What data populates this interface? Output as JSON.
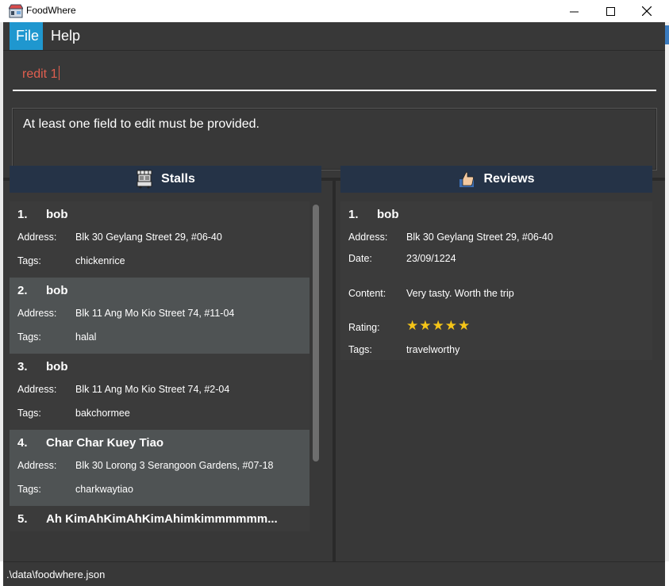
{
  "window": {
    "title": "FoodWhere"
  },
  "menu": {
    "file": "File",
    "help": "Help"
  },
  "command": {
    "value": "redit 1"
  },
  "result": {
    "message": "At least one field to edit must be provided."
  },
  "stalls": {
    "header": "Stalls",
    "labels": {
      "address": "Address:",
      "tags": "Tags:"
    },
    "items": [
      {
        "index": "1.",
        "name": "bob",
        "address": "Blk 30 Geylang Street 29, #06-40",
        "tags": "chickenrice"
      },
      {
        "index": "2.",
        "name": "bob",
        "address": "Blk 11 Ang Mo Kio Street 74, #11-04",
        "tags": "halal"
      },
      {
        "index": "3.",
        "name": "bob",
        "address": "Blk 11 Ang Mo Kio Street 74, #2-04",
        "tags": "bakchormee"
      },
      {
        "index": "4.",
        "name": "Char Char Kuey Tiao",
        "address": "Blk 30 Lorong 3 Serangoon Gardens, #07-18",
        "tags": "charkwaytiao"
      },
      {
        "index": "5.",
        "name": "Ah KimAhKimAhKimAhimkimmmmmm..."
      }
    ]
  },
  "reviews": {
    "header": "Reviews",
    "labels": {
      "address": "Address:",
      "date": "Date:",
      "content": "Content:",
      "rating": "Rating:",
      "tags": "Tags:"
    },
    "items": [
      {
        "index": "1.",
        "name": "bob",
        "address": "Blk 30 Geylang Street 29, #06-40",
        "date": "23/09/1224",
        "content": "Very tasty. Worth the trip",
        "rating": 5,
        "tags": "travelworthy"
      }
    ]
  },
  "status": {
    "path": ".\\data\\foodwhere.json"
  },
  "colors": {
    "accent": "#1f97cf",
    "header_bg": "#253347",
    "command_text": "#e15f4f",
    "star": "#f5c518"
  }
}
